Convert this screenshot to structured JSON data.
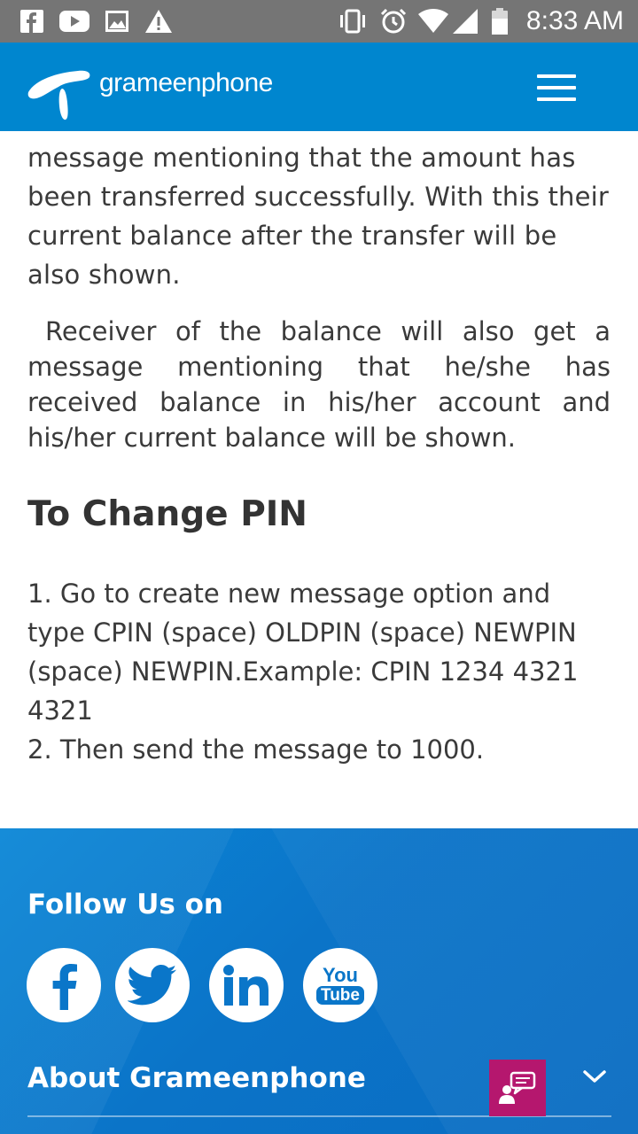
{
  "status_bar": {
    "time": "8:33 AM",
    "left_icons": [
      "facebook-notification-icon",
      "youtube-notification-icon",
      "image-notification-icon",
      "warning-icon"
    ],
    "right_icons": [
      "vibrate-icon",
      "alarm-icon",
      "wifi-icon",
      "signal-icon",
      "battery-icon"
    ]
  },
  "header": {
    "brand": "grameenphone",
    "menu_icon": "hamburger-menu-icon",
    "background": "#0086cf"
  },
  "content": {
    "paragraph_1": "message mentioning that the amount has been transferred successfully. With this their current balance after the transfer will be also shown.",
    "paragraph_2": "Receiver of the balance will also get a message mentioning that he/she has received balance in his/her account and his/her current balance will be shown.",
    "section_title": "To Change PIN",
    "steps": [
      "1. Go to create new message option and type CPIN (space) OLDPIN (space) NEWPIN (space) NEWPIN.Example: CPIN 1234 4321 4321",
      "2. Then send the message to 1000."
    ]
  },
  "footer": {
    "follow_title": "Follow Us on",
    "social": [
      {
        "name": "facebook-icon"
      },
      {
        "name": "twitter-icon"
      },
      {
        "name": "linkedin-icon"
      },
      {
        "name": "youtube-icon",
        "label_top": "You",
        "label_bottom": "Tube"
      }
    ],
    "about_label": "About Grameenphone",
    "chat_icon": "chat-support-icon",
    "chevron_icon": "chevron-down-icon",
    "chat_color": "#b5176e"
  }
}
